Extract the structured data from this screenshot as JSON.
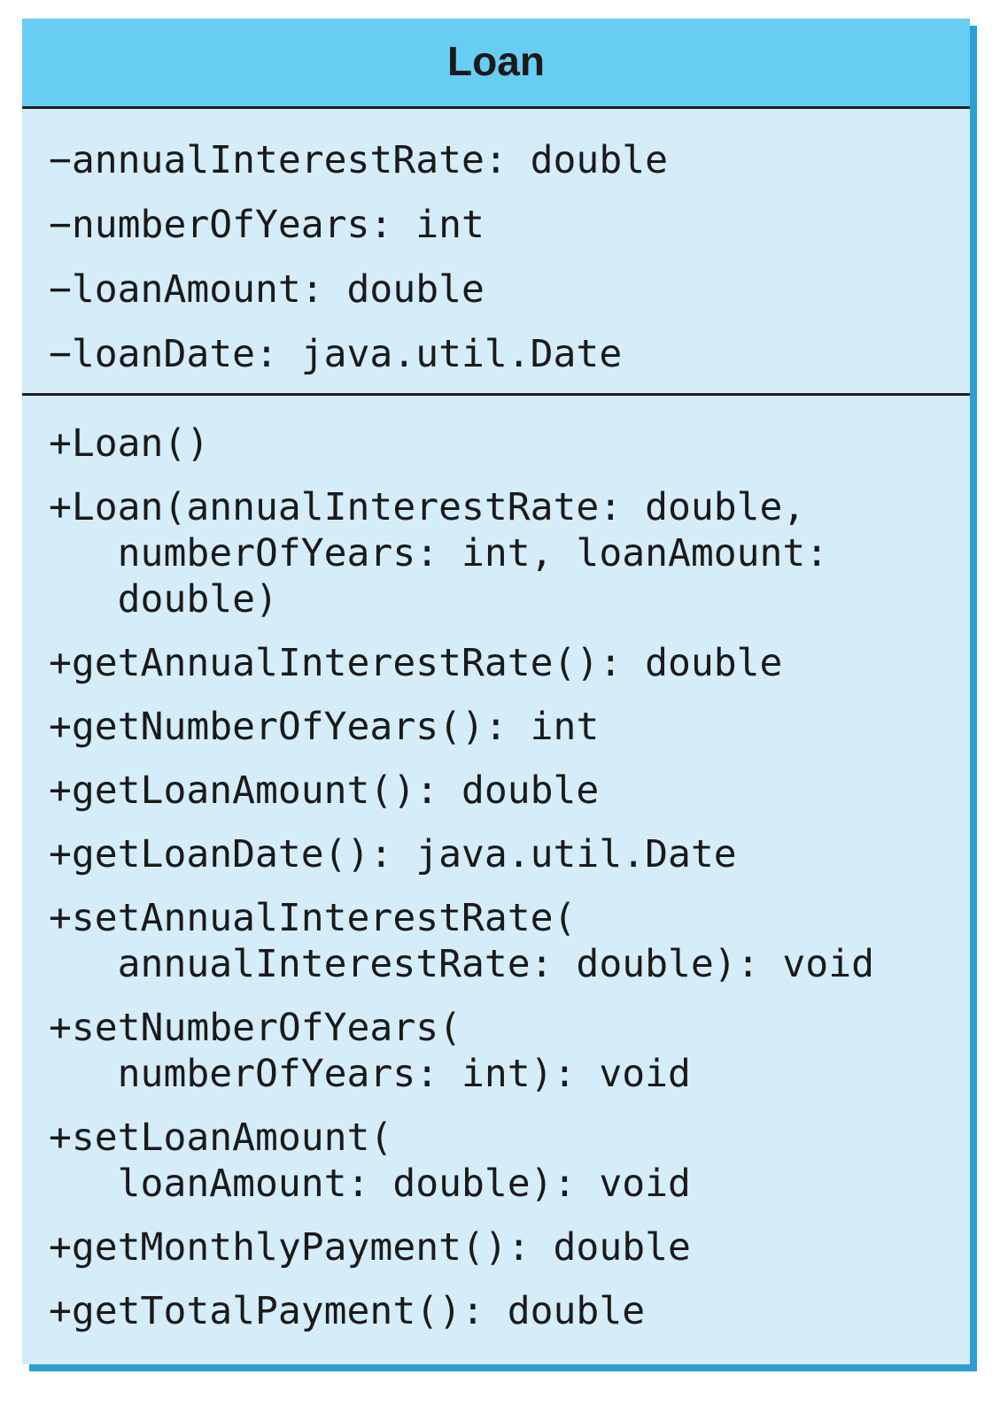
{
  "class_name": "Loan",
  "attributes": [
    "−annualInterestRate: double",
    "−numberOfYears: int",
    "−loanAmount: double",
    "−loanDate: java.util.Date"
  ],
  "methods": [
    "+Loan()",
    "+Loan(annualInterestRate: double,\n   numberOfYears: int, loanAmount:\n   double)",
    "+getAnnualInterestRate(): double",
    "+getNumberOfYears(): int",
    "+getLoanAmount(): double",
    "+getLoanDate(): java.util.Date",
    "+setAnnualInterestRate(\n   annualInterestRate: double): void",
    "+setNumberOfYears(\n   numberOfYears: int): void",
    "+setLoanAmount(\n   loanAmount: double): void",
    "+getMonthlyPayment(): double",
    "+getTotalPayment(): double"
  ],
  "colors": {
    "header": "#68cdf3",
    "body": "#d5ecf9",
    "shadow": "#2b9fd4"
  }
}
